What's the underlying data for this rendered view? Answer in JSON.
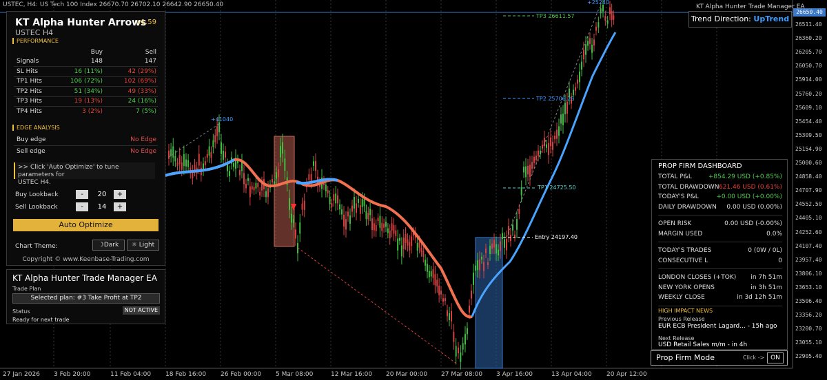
{
  "header": {
    "symbol_info": "USTEC, H4:  US Tech 100 Index  26670.70 26702.10 26642.90 26650.40"
  },
  "price_axis": {
    "current_price": "26650.40",
    "ticks": [
      "26511.40",
      "26360.20",
      "26205.70",
      "26050.70",
      "25914.00",
      "25760.20",
      "25609.10",
      "25454.40",
      "25309.50",
      "25154.90",
      "25000.60",
      "24858.40",
      "24707.90",
      "24552.50",
      "24405.10",
      "24252.60",
      "24107.40",
      "23957.40",
      "23806.10",
      "23653.10",
      "23506.40",
      "23356.20",
      "23200.70",
      "23055.10",
      "22905.40"
    ]
  },
  "time_axis": [
    "27 Jan 2026",
    "3 Feb 20:00",
    "11 Feb 04:00",
    "18 Feb 16:00",
    "26 Feb 00:00",
    "5 Mar 08:00",
    "12 Mar 16:00",
    "20 Mar 00:00",
    "27 Mar 08:00",
    "3 Apr 16:00",
    "13 Apr 04:00",
    "20 Apr 12:00"
  ],
  "chart_labels": {
    "tp3": "TP3 26611.57",
    "tp2": "TP2 25706.25",
    "tp1": "TP1 24725.50",
    "entry": "Entry  24197.40",
    "swing_high": "+41040",
    "top_marker": "+25240"
  },
  "arrows_panel": {
    "title": "KT Alpha Hunter Arrows",
    "version": "v1.59",
    "symbol": "USTEC  H4",
    "performance_label": "PERFORMANCE",
    "col_buy": "Buy",
    "col_sell": "Sell",
    "rows": [
      {
        "label": "Signals",
        "buy": "148",
        "sell": "147"
      },
      {
        "label": "SL Hits",
        "buy": "16 (11%)",
        "sell": "42 (29%)"
      },
      {
        "label": "TP1 Hits",
        "buy": "106 (72%)",
        "sell": "102 (69%)"
      },
      {
        "label": "TP2 Hits",
        "buy": "51 (34%)",
        "sell": "49 (33%)"
      },
      {
        "label": "TP3 Hits",
        "buy": "19 (13%)",
        "sell": "24 (16%)"
      },
      {
        "label": "TP4 Hits",
        "buy": "3 (2%)",
        "sell": "7 (5%)"
      }
    ],
    "edge_label": "EDGE ANALYSIS",
    "buy_edge_label": "Buy edge",
    "buy_edge_value": "No Edge",
    "sell_edge_label": "Sell edge",
    "sell_edge_value": "No Edge",
    "hint_line1": ">> Click 'Auto Optimize' to tune parameters for",
    "hint_line2": "USTEC H4.",
    "buy_lookback_label": "Buy Lookback",
    "buy_lookback_value": "20",
    "sell_lookback_label": "Sell Lookback",
    "sell_lookback_value": "14",
    "minus": "-",
    "plus": "+",
    "optimize_label": "Auto Optimize",
    "theme_label": "Chart Theme:",
    "theme_dark": "Dark",
    "theme_light": "Light",
    "copyright": "Copyright © www.Keenbase-Trading.com"
  },
  "trade_manager": {
    "title": "KT Alpha Hunter Trade Manager EA",
    "plan_label": "Trade Plan",
    "plan_value": "Selected plan: #3 Take Profit at TP2",
    "status_label": "Status",
    "status_value": "NOT ACTIVE",
    "ready": "Ready for next trade"
  },
  "trend": {
    "ea_title": "KT Alpha Hunter Trade Manager EA",
    "label": "Trend Direction:",
    "value": "UpTrend"
  },
  "prop_firm": {
    "title": "PROP FIRM DASHBOARD",
    "rows1": [
      {
        "label": "TOTAL P&L",
        "value": "+854.29 USD (+0.85%)",
        "color": "#4ec94e"
      },
      {
        "label": "TOTAL DRAWDOWN",
        "value": "621.46 USD (0.61%)",
        "color": "#e0443a"
      },
      {
        "label": "TODAY'S P&L",
        "value": "+0.00 USD (+0.00%)",
        "color": "#4ec94e"
      },
      {
        "label": "DAILY DRAWDOWN",
        "value": "0.00 USD (0.00%)",
        "color": "#dddddd"
      }
    ],
    "rows2": [
      {
        "label": "OPEN RISK",
        "value": "0.00 USD (-0.00%)"
      },
      {
        "label": "MARGIN USED",
        "value": "0.0%"
      }
    ],
    "rows3": [
      {
        "label": "TODAY'S TRADES",
        "value": "0 (0W / 0L)"
      },
      {
        "label": "CONSECUTIVE L",
        "value": "0"
      }
    ],
    "rows4": [
      {
        "label": "LONDON CLOSES (+TOK)",
        "value": "in 7h 51m"
      },
      {
        "label": "NEW YORK OPENS",
        "value": "in 3h 51m"
      },
      {
        "label": "WEEKLY CLOSE",
        "value": "in 3d 12h 51m"
      }
    ],
    "news_label": "HIGH IMPACT NEWS",
    "prev_label": "Previous Release",
    "prev_value": "EUR ECB President Lagard... - 15h ago",
    "next_label": "Next Release",
    "next_value": "USD Retail Sales m/m - in 4h",
    "mode_label": "Prop Firm Mode",
    "mode_click": "Click ->",
    "mode_state": "ON"
  }
}
